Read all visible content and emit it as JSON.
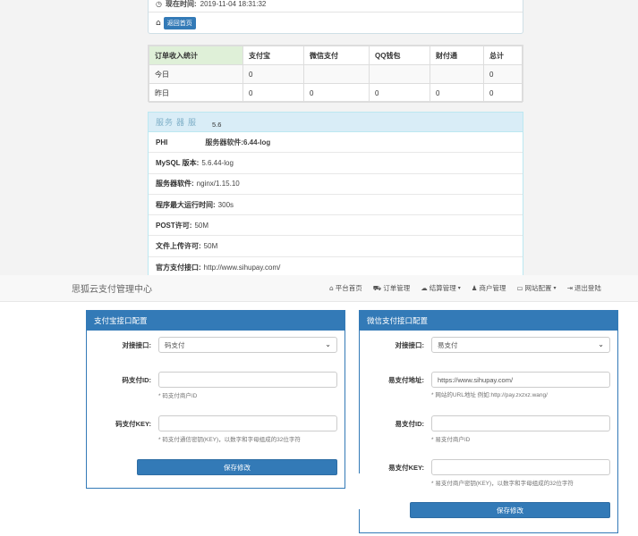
{
  "time_panel": {
    "label": "现在时间:",
    "value": "2019-11-04 18:31:32",
    "home_button": "返回首页"
  },
  "orders": {
    "headers": [
      "订单收入统计",
      "支付宝",
      "微信支付",
      "QQ钱包",
      "财付通",
      "总计"
    ],
    "rows": [
      [
        "今日",
        "0",
        "",
        "",
        "",
        "0"
      ],
      [
        "昨日",
        "0",
        "0",
        "0",
        "0",
        "0"
      ]
    ]
  },
  "server": {
    "title_left": "服务",
    "title_mid": "器",
    "title_right": "服",
    "title_version": "5.6",
    "rows": [
      {
        "k": "PHI",
        "v": "服务器软件:6.44-log"
      },
      {
        "k": "MySQL 版本:",
        "v": "5.6.44-log"
      },
      {
        "k": "服务器软件:",
        "v": "nginx/1.15.10"
      },
      {
        "k": "程序最大运行时间:",
        "v": "300s"
      },
      {
        "k": "POST许可:",
        "v": "50M"
      },
      {
        "k": "文件上传许可:",
        "v": "50M"
      },
      {
        "k": "官方支付接口:",
        "v": "http://www.sihupay.com/"
      }
    ]
  },
  "navbar": {
    "brand": "思狐云支付管理中心",
    "items": [
      {
        "icon": "home-icon",
        "glyph": "🏠",
        "label": "平台首页",
        "caret": ""
      },
      {
        "icon": "cart-icon",
        "glyph": "🛒",
        "label": "订单管理",
        "caret": ""
      },
      {
        "icon": "cloud-icon",
        "glyph": "☁",
        "label": "结算管理",
        "caret": "▾"
      },
      {
        "icon": "user-icon",
        "glyph": "👤",
        "label": "商户管理",
        "caret": ""
      },
      {
        "icon": "monitor-icon",
        "glyph": "🖥",
        "label": "网站配置",
        "caret": "▾"
      },
      {
        "icon": "logout-icon",
        "glyph": "⇥",
        "label": "退出登陆",
        "caret": ""
      }
    ]
  },
  "alipay": {
    "title": "支付宝接口配置",
    "iface_label": "对接接口:",
    "iface_value": "码支付",
    "id_label": "码支付ID:",
    "id_value": "",
    "id_help": "* 码支付商户ID",
    "key_label": "码支付KEY:",
    "key_value": "",
    "key_help": "* 码支付通信密钥(KEY)，以数字和字母组成的32位字符",
    "save": "保存修改"
  },
  "wechat": {
    "title": "微信支付接口配置",
    "iface_label": "对接接口:",
    "iface_value": "易支付",
    "url_label": "易支付地址:",
    "url_value": "https://www.sihupay.com/",
    "url_help": "* 网站的URL地址 例如:http://pay.zxzxz.wang/",
    "id_label": "易支付ID:",
    "id_value": "",
    "id_help": "* 易支付商户ID",
    "key_label": "易支付KEY:",
    "key_value": "",
    "key_help": "* 易支付商户密钥(KEY)，以数字和字母组成的32位字符",
    "save": "保存修改"
  },
  "colors": {
    "primary": "#337ab7",
    "info_bg": "#d9edf7",
    "success_bg": "#dff0d8"
  }
}
